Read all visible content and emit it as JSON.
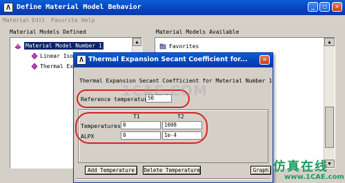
{
  "main_window": {
    "title": "Define Material Model Behavior",
    "menu": [
      "Material",
      "Edit",
      "Favorite",
      "Help"
    ],
    "left_panel": {
      "title": "Material Models Defined",
      "tree": {
        "selected": "Material Model Number 1",
        "children": [
          "Linear Isotropic",
          "Thermal Expansion"
        ],
        "children_visible": [
          "Linear Isot",
          "Thermal Exp"
        ]
      }
    },
    "right_panel": {
      "title": "Material Models Available",
      "items": [
        "Favorites"
      ]
    }
  },
  "dialog": {
    "title": "Thermal Expansion Secant Coefficient for...",
    "subtitle": "Thermal Expansion Secant Coefficient for Material Number 1",
    "reference": {
      "label": "Reference temperature",
      "value": "50"
    },
    "table": {
      "columns": [
        "T1",
        "T2"
      ],
      "rows": [
        {
          "label": "Temperatures",
          "values": [
            "0",
            "1008"
          ]
        },
        {
          "label": "ALPX",
          "values": [
            "0",
            "1e-4"
          ]
        }
      ]
    },
    "buttons": {
      "add_temperature": "Add Temperature",
      "delete_temperature": "Delete Temperature",
      "graph": "Graph"
    }
  },
  "watermark": {
    "center": "1CAE.COM",
    "corner_title": "仿真在线",
    "corner_url": "www.1CAE.com"
  },
  "colors": {
    "titlebar": "#0a4fc8",
    "highlight": "#0a246a",
    "annotation": "#d62020",
    "watermark": "#1c9a5e"
  }
}
